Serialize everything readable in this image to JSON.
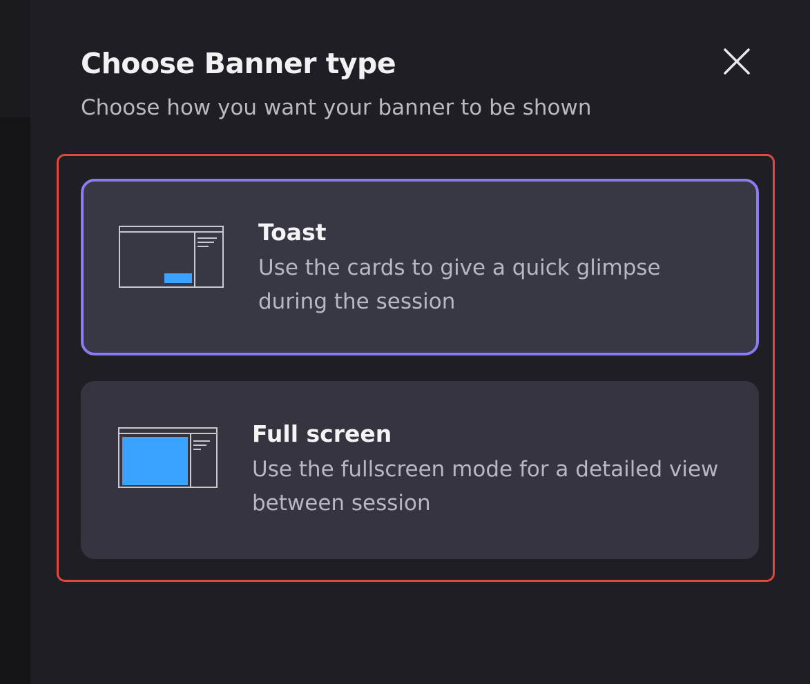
{
  "dialog": {
    "title": "Choose Banner type",
    "subtitle": "Choose how you want your banner to be shown",
    "close_icon": "close-icon"
  },
  "options": [
    {
      "id": "toast",
      "title": "Toast",
      "description": "Use the cards to give a quick glimpse during the session",
      "icon": "toast-layout-icon",
      "selected": true
    },
    {
      "id": "fullscreen",
      "title": "Full screen",
      "description": "Use the fullscreen mode for a detailed view between session",
      "icon": "fullscreen-layout-icon",
      "selected": false
    }
  ],
  "colors": {
    "panel_bg": "#1e1e24",
    "card_bg": "#383744",
    "selected_border": "#8b7bf5",
    "thumbnail_accent": "#3aa3ff",
    "highlight_frame": "#e0493b"
  }
}
